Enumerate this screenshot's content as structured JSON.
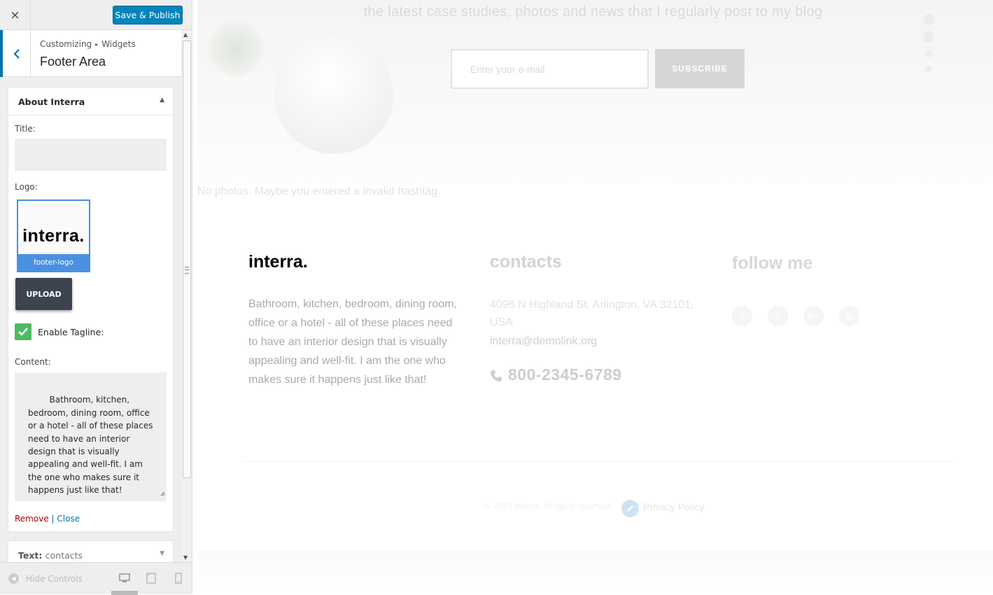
{
  "topbar": {
    "close_glyph": "×",
    "save_label": "Save & Publish"
  },
  "section": {
    "breadcrumb_root": "Customizing",
    "breadcrumb_sep": "▸",
    "breadcrumb_parent": "Widgets",
    "title": "Footer Area"
  },
  "widget": {
    "title": "About Interra",
    "toggle_glyph": "▲",
    "title_label": "Title:",
    "title_value": "",
    "logo_label": "Logo:",
    "logo_text": "interra.",
    "logo_caption": "footer-logo",
    "upload_label": "UPLOAD",
    "tagline_label": "Enable Tagline:",
    "tagline_checked": true,
    "content_label": "Content:",
    "content_value": "Bathroom, kitchen, bedroom, dining room, office or a hotel - all of these places need to have an interior design that is visually appealing and well-fit. I am the one who makes sure it happens just like that!",
    "remove_label": "Remove",
    "links_sep": "|",
    "close_label": "Close"
  },
  "widget2": {
    "title_prefix": "Text:",
    "title_name": "contacts",
    "toggle_glyph": "▼"
  },
  "footer_controls": {
    "hide_label": "Hide Controls",
    "devices": [
      "desktop-icon",
      "tablet-icon",
      "mobile-icon"
    ]
  },
  "preview": {
    "hero_text": "the latest case studies, photos and news that I regularly post to my blog",
    "email_placeholder": "Enter your e-mail",
    "subscribe_label": "SUBSCRIBE",
    "no_photos": "No photos. Maybe you entered a invalid hashtag.",
    "footer_logo": "interra.",
    "footer_about": "Bathroom, kitchen, bedroom, dining room, office or a hotel - all of these places need to have an interior design that is visually appealing and well-fit. I am the one who makes sure it happens just like that!",
    "contacts_heading": "contacts",
    "contacts_address": "4096 N Highland St, Arlington, VA 32101, USA",
    "contacts_email": "interra@demolink.org",
    "contacts_phone": "800-2345-6789",
    "follow_heading": "follow me",
    "social": [
      {
        "name": "facebook-icon",
        "glyph": "f"
      },
      {
        "name": "twitter-icon",
        "glyph": "t"
      },
      {
        "name": "google-plus-icon",
        "glyph": "G+"
      },
      {
        "name": "instagram-icon",
        "glyph": "◎"
      }
    ],
    "copyright": "© 2017 Interra. All rights reserved",
    "privacy_label": "Privacy Policy"
  },
  "colors": {
    "accent": "#0073aa",
    "publish_button": "#0085ba",
    "logo_border": "#4a90e2",
    "upload_button": "#3d4450",
    "checkbox": "#4cbb63",
    "remove_link": "#aa0000"
  }
}
